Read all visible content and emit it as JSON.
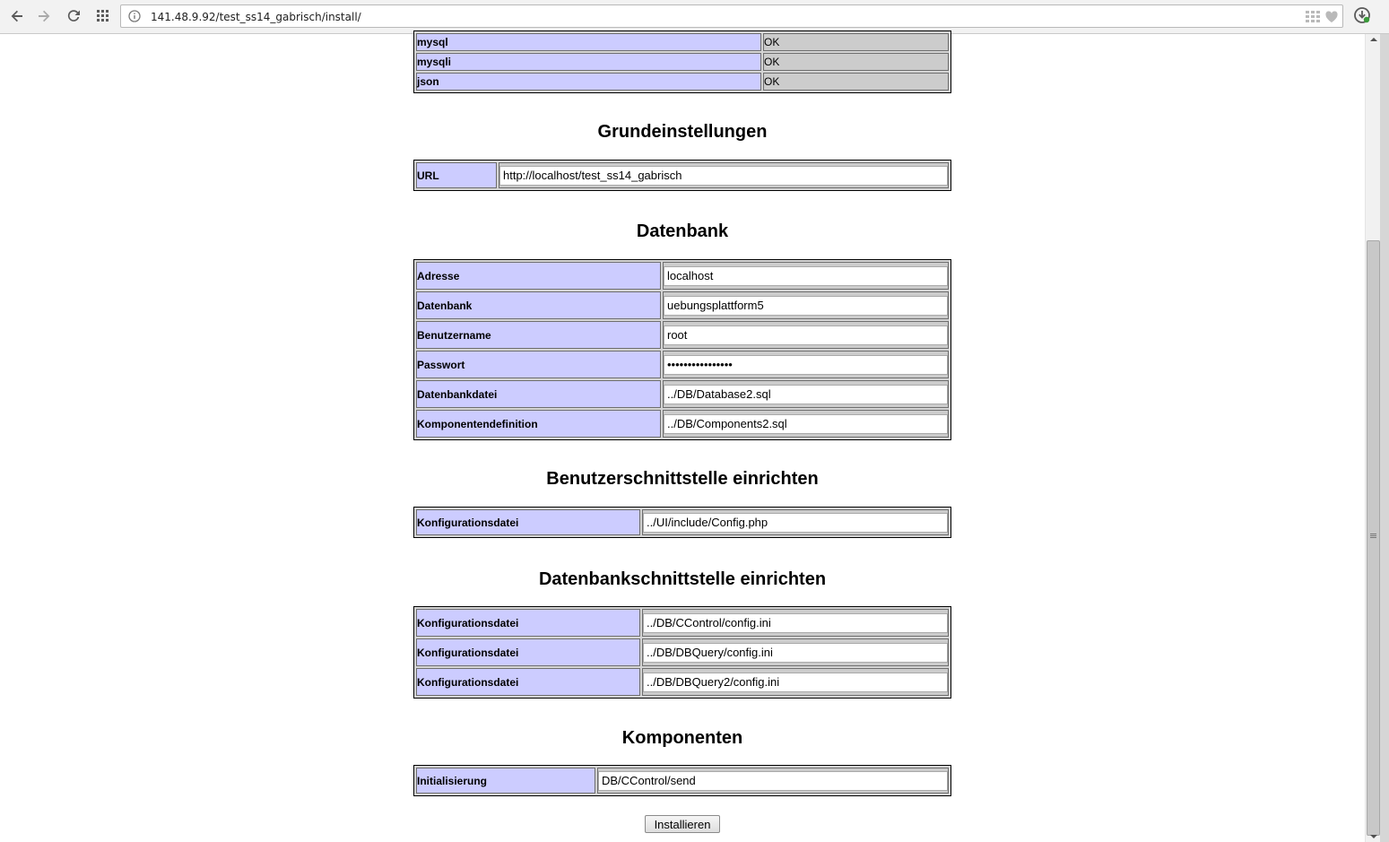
{
  "browser": {
    "url": "141.48.9.92/test_ss14_gabrisch/install/"
  },
  "extensions": {
    "rows": [
      {
        "name": "mysql",
        "status": "OK"
      },
      {
        "name": "mysqli",
        "status": "OK"
      },
      {
        "name": "json",
        "status": "OK"
      }
    ]
  },
  "grundeinstellungen": {
    "title": "Grundeinstellungen",
    "url_label": "URL",
    "url_value": "http://localhost/test_ss14_gabrisch"
  },
  "datenbank": {
    "title": "Datenbank",
    "fields": [
      {
        "label": "Adresse",
        "value": "localhost"
      },
      {
        "label": "Datenbank",
        "value": "uebungsplattform5"
      },
      {
        "label": "Benutzername",
        "value": "root"
      },
      {
        "label": "Passwort",
        "value": "••••••••••••••••"
      },
      {
        "label": "Datenbankdatei",
        "value": "../DB/Database2.sql"
      },
      {
        "label": "Komponentendefinition",
        "value": "../DB/Components2.sql"
      }
    ]
  },
  "benutzerschnittstelle": {
    "title": "Benutzerschnittstelle einrichten",
    "label": "Konfigurationsdatei",
    "value": "../UI/include/Config.php"
  },
  "datenbankschnittstelle": {
    "title": "Datenbankschnittstelle einrichten",
    "fields": [
      {
        "label": "Konfigurationsdatei",
        "value": "../DB/CControl/config.ini"
      },
      {
        "label": "Konfigurationsdatei",
        "value": "../DB/DBQuery/config.ini"
      },
      {
        "label": "Konfigurationsdatei",
        "value": "../DB/DBQuery2/config.ini"
      }
    ]
  },
  "komponenten": {
    "title": "Komponenten",
    "label": "Initialisierung",
    "value": "DB/CControl/send"
  },
  "install_button": "Installieren"
}
